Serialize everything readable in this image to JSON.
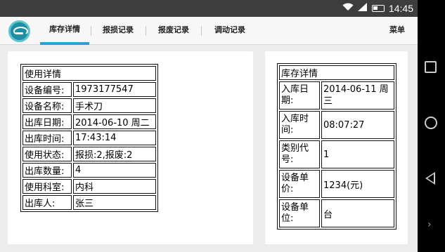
{
  "status_bar": {
    "time": "14:45",
    "icons": [
      "wifi-icon",
      "signal-icon",
      "battery-icon"
    ]
  },
  "app_bar": {
    "logo": "app-logo-icon",
    "tabs": [
      {
        "label": "库存详情",
        "active": true
      },
      {
        "label": "报损记录",
        "active": false
      },
      {
        "label": "报废记录",
        "active": false
      },
      {
        "label": "调动记录",
        "active": false
      }
    ],
    "menu_label": "菜单"
  },
  "usage_details": {
    "title": "使用详情",
    "rows": [
      {
        "label": "设备编号:",
        "value": "1973177547"
      },
      {
        "label": "设备名称:",
        "value": "手术刀"
      },
      {
        "label": "出库日期:",
        "value": "2014-06-10 周二"
      },
      {
        "label": "出库时间:",
        "value": "17:43:14"
      },
      {
        "label": "使用状态:",
        "value": "报损:2,报废:2"
      },
      {
        "label": "出库数量:",
        "value": "4"
      },
      {
        "label": "使用科室:",
        "value": "内科"
      },
      {
        "label": "出库人:",
        "value": "张三"
      }
    ]
  },
  "inventory_details": {
    "title": "库存详情",
    "rows": [
      {
        "label": "入库日期:",
        "value": "2014-06-11 周三"
      },
      {
        "label": "入库时间:",
        "value": "08:07:27"
      },
      {
        "label": "类别代号:",
        "value": "1"
      },
      {
        "label": "设备单价:",
        "value": "1234(元)"
      },
      {
        "label": "设备单位:",
        "value": "台"
      }
    ]
  },
  "nav_bar": {
    "buttons": [
      "recents-square-icon",
      "home-circle-icon",
      "back-triangle-icon",
      "chevron-right-icon"
    ]
  }
}
